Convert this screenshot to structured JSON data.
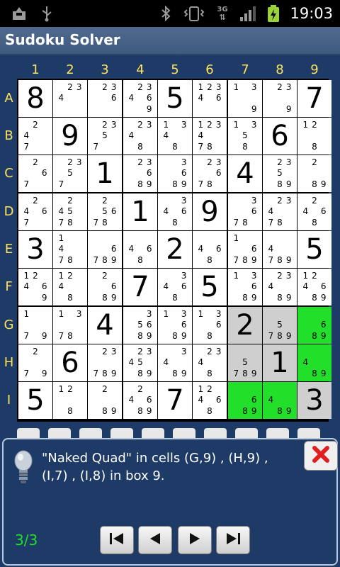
{
  "status_bar": {
    "time": "19:03",
    "network": "3G"
  },
  "app": {
    "title": "Sudoku Solver"
  },
  "columns": [
    "1",
    "2",
    "3",
    "4",
    "5",
    "6",
    "7",
    "8",
    "9"
  ],
  "rows": [
    "A",
    "B",
    "C",
    "D",
    "E",
    "F",
    "G",
    "H",
    "I"
  ],
  "grid": [
    [
      {
        "v": "8"
      },
      {
        "c": [
          "",
          "2",
          "3",
          "4",
          "",
          "",
          "",
          "",
          ""
        ]
      },
      {
        "c": [
          "",
          "2",
          "3",
          "",
          "",
          "6",
          "",
          "",
          ""
        ]
      },
      {
        "c": [
          "",
          "2",
          "3",
          "4",
          "",
          "6",
          "",
          "",
          "9"
        ]
      },
      {
        "v": "5"
      },
      {
        "c": [
          "1",
          "2",
          "3",
          "4",
          "",
          "6",
          "",
          "",
          ""
        ]
      },
      {
        "c": [
          "1",
          "",
          "3",
          "",
          "",
          "",
          "",
          "",
          "9"
        ]
      },
      {
        "c": [
          "",
          "2",
          "3",
          "",
          "",
          "",
          "",
          "",
          "9"
        ]
      },
      {
        "v": "7"
      }
    ],
    [
      {
        "c": [
          "",
          "2",
          "",
          "4",
          "",
          "",
          "7",
          "",
          ""
        ]
      },
      {
        "v": "9"
      },
      {
        "c": [
          "",
          "2",
          "3",
          "",
          "5",
          "",
          "7",
          "",
          ""
        ]
      },
      {
        "c": [
          "",
          "2",
          "3",
          "4",
          "",
          "",
          "",
          "8",
          ""
        ]
      },
      {
        "c": [
          "1",
          "",
          "3",
          "4",
          "",
          "",
          "",
          "8",
          ""
        ]
      },
      {
        "c": [
          "1",
          "2",
          "3",
          "4",
          "",
          "",
          "7",
          "8",
          ""
        ]
      },
      {
        "c": [
          "1",
          "",
          "3",
          "",
          "5",
          "",
          "",
          "8",
          ""
        ]
      },
      {
        "v": "6"
      },
      {
        "c": [
          "1",
          "2",
          "",
          "",
          "",
          "",
          "",
          "8",
          ""
        ]
      }
    ],
    [
      {
        "c": [
          "",
          "2",
          "",
          "",
          "",
          "6",
          "7",
          "",
          ""
        ]
      },
      {
        "c": [
          "",
          "2",
          "3",
          "",
          "5",
          "",
          "7",
          "",
          ""
        ]
      },
      {
        "v": "1"
      },
      {
        "c": [
          "",
          "2",
          "3",
          "",
          "",
          "6",
          "",
          "8",
          "9"
        ]
      },
      {
        "c": [
          "",
          "",
          "3",
          "",
          "",
          "6",
          "",
          "8",
          "9"
        ]
      },
      {
        "c": [
          "",
          "2",
          "3",
          "",
          "",
          "6",
          "7",
          "8",
          ""
        ]
      },
      {
        "v": "4"
      },
      {
        "c": [
          "",
          "2",
          "3",
          "",
          "5",
          "",
          "",
          "8",
          "9"
        ]
      },
      {
        "c": [
          "",
          "2",
          "",
          "",
          "",
          "",
          "",
          "8",
          "9"
        ]
      }
    ],
    [
      {
        "c": [
          "",
          "2",
          "",
          "4",
          "",
          "6",
          "7",
          "",
          ""
        ]
      },
      {
        "c": [
          "",
          "2",
          "",
          "4",
          "5",
          "",
          "7",
          "8",
          ""
        ]
      },
      {
        "c": [
          "",
          "2",
          "",
          "",
          "5",
          "6",
          "7",
          "8",
          ""
        ]
      },
      {
        "v": "1"
      },
      {
        "c": [
          "",
          "",
          "3",
          "4",
          "",
          "6",
          "",
          "8",
          ""
        ]
      },
      {
        "v": "9"
      },
      {
        "c": [
          "",
          "",
          "3",
          "",
          "",
          "6",
          "7",
          "8",
          ""
        ]
      },
      {
        "c": [
          "",
          "2",
          "3",
          "4",
          "",
          "",
          "7",
          "8",
          ""
        ]
      },
      {
        "c": [
          "",
          "2",
          "",
          "4",
          "",
          "6",
          "",
          "8",
          ""
        ]
      }
    ],
    [
      {
        "v": "3"
      },
      {
        "c": [
          "1",
          "",
          "",
          "4",
          "",
          "",
          "7",
          "8",
          ""
        ]
      },
      {
        "c": [
          "",
          "",
          "",
          "",
          "",
          "6",
          "7",
          "8",
          "9"
        ]
      },
      {
        "c": [
          "",
          "",
          "",
          "4",
          "",
          "6",
          "",
          "8",
          ""
        ]
      },
      {
        "v": "2"
      },
      {
        "c": [
          "",
          "",
          "",
          "4",
          "",
          "6",
          "",
          "8",
          ""
        ]
      },
      {
        "c": [
          "1",
          "",
          "",
          "",
          "",
          "6",
          "7",
          "8",
          "9"
        ]
      },
      {
        "c": [
          "",
          "",
          "",
          "4",
          "",
          "",
          "7",
          "8",
          "9"
        ]
      },
      {
        "v": "5"
      }
    ],
    [
      {
        "c": [
          "1",
          "2",
          "",
          "4",
          "",
          "6",
          "",
          "",
          "9"
        ]
      },
      {
        "c": [
          "1",
          "2",
          "",
          "4",
          "",
          "",
          "",
          "8",
          ""
        ]
      },
      {
        "c": [
          "",
          "2",
          "",
          "",
          "",
          "6",
          "",
          "8",
          "9"
        ]
      },
      {
        "v": "7"
      },
      {
        "c": [
          "",
          "",
          "3",
          "4",
          "",
          "6",
          "",
          "8",
          ""
        ]
      },
      {
        "v": "5"
      },
      {
        "c": [
          "1",
          "",
          "3",
          "",
          "",
          "6",
          "",
          "8",
          "9"
        ]
      },
      {
        "c": [
          "",
          "2",
          "3",
          "4",
          "",
          "",
          "",
          "8",
          "9"
        ]
      },
      {
        "c": [
          "1",
          "2",
          "",
          "4",
          "",
          "6",
          "",
          "8",
          "9"
        ]
      }
    ],
    [
      {
        "c": [
          "1",
          "",
          "",
          "",
          "",
          "",
          "7",
          "",
          "9"
        ]
      },
      {
        "c": [
          "1",
          "",
          "3",
          "",
          "",
          "",
          "7",
          "8",
          ""
        ]
      },
      {
        "v": "4"
      },
      {
        "c": [
          "",
          "",
          "3",
          "",
          "5",
          "6",
          "",
          "8",
          "9"
        ]
      },
      {
        "c": [
          "1",
          "",
          "3",
          "",
          "",
          "6",
          "",
          "8",
          "9"
        ]
      },
      {
        "c": [
          "1",
          "",
          "3",
          "",
          "",
          "6",
          "",
          "8",
          ""
        ]
      },
      {
        "v": "2",
        "bg": "gray"
      },
      {
        "c": [
          "",
          "",
          "",
          "",
          "5",
          "",
          "7",
          "8",
          "9"
        ],
        "bg": "gray"
      },
      {
        "c": [
          "",
          "",
          "",
          "",
          "",
          "6",
          "",
          "8",
          "9"
        ],
        "bg": "green"
      }
    ],
    [
      {
        "c": [
          "",
          "2",
          "",
          "",
          "",
          "",
          "7",
          "",
          "9"
        ]
      },
      {
        "v": "6"
      },
      {
        "c": [
          "",
          "2",
          "3",
          "",
          "",
          "",
          "7",
          "8",
          "9"
        ]
      },
      {
        "c": [
          "",
          "2",
          "3",
          "4",
          "5",
          "",
          "",
          "8",
          "9"
        ]
      },
      {
        "c": [
          "",
          "",
          "3",
          "4",
          "",
          "",
          "",
          "8",
          "9"
        ]
      },
      {
        "c": [
          "",
          "2",
          "3",
          "4",
          "",
          "",
          "",
          "8",
          ""
        ]
      },
      {
        "c": [
          "",
          "",
          "",
          "",
          "5",
          "",
          "7",
          "8",
          "9"
        ],
        "bg": "gray"
      },
      {
        "v": "1",
        "bg": "gray"
      },
      {
        "c": [
          "",
          "",
          "",
          "4",
          "",
          "",
          "",
          "8",
          "9"
        ],
        "bg": "green"
      }
    ],
    [
      {
        "v": "5"
      },
      {
        "c": [
          "1",
          "2",
          "",
          "",
          "",
          "",
          "",
          "8",
          ""
        ]
      },
      {
        "c": [
          "",
          "2",
          "",
          "",
          "",
          "",
          "",
          "8",
          "9"
        ]
      },
      {
        "c": [
          "",
          "2",
          "",
          "4",
          "",
          "6",
          "",
          "8",
          "9"
        ]
      },
      {
        "v": "7"
      },
      {
        "c": [
          "1",
          "2",
          "",
          "4",
          "",
          "6",
          "",
          "8",
          ""
        ]
      },
      {
        "c": [
          "",
          "",
          "",
          "",
          "",
          "6",
          "",
          "8",
          "9"
        ],
        "bg": "green"
      },
      {
        "c": [
          "",
          "",
          "",
          "4",
          "",
          "",
          "",
          "8",
          "9"
        ],
        "bg": "green"
      },
      {
        "v": "3",
        "bg": "gray"
      }
    ]
  ],
  "hint_panel": {
    "message": "\"Naked Quad\" in cells (G,9) , (H,9) , (I,7) , (I,8)  in  box 9.",
    "counter": "3/3"
  },
  "colors": {
    "highlight_green": "#22e02a",
    "label_yellow": "#ffe35a",
    "panel_bg": "#1e3a66"
  }
}
